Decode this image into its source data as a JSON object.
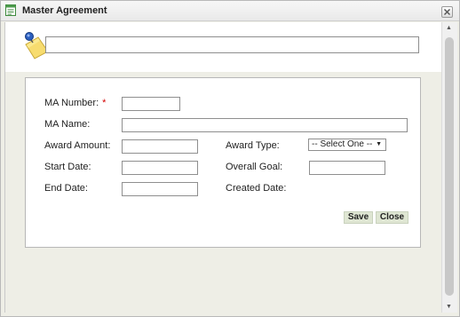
{
  "window": {
    "title": "Master Agreement",
    "title_icon": "form-icon",
    "close_icon": "close-icon"
  },
  "header": {
    "icon": "sticky-note-pin-icon",
    "name_value": ""
  },
  "form": {
    "ma_number_label": "MA Number:",
    "required_mark": "*",
    "ma_number_value": "",
    "ma_name_label": "MA Name:",
    "ma_name_value": "",
    "award_amount_label": "Award Amount:",
    "award_amount_value": "",
    "award_type_label": "Award Type:",
    "award_type_selected": "-- Select One --",
    "start_date_label": "Start Date:",
    "start_date_value": "",
    "overall_goal_label": "Overall Goal:",
    "overall_goal_value": "",
    "end_date_label": "End Date:",
    "end_date_value": "",
    "created_date_label": "Created Date:"
  },
  "actions": {
    "save_label": "Save",
    "close_label": "Close"
  }
}
